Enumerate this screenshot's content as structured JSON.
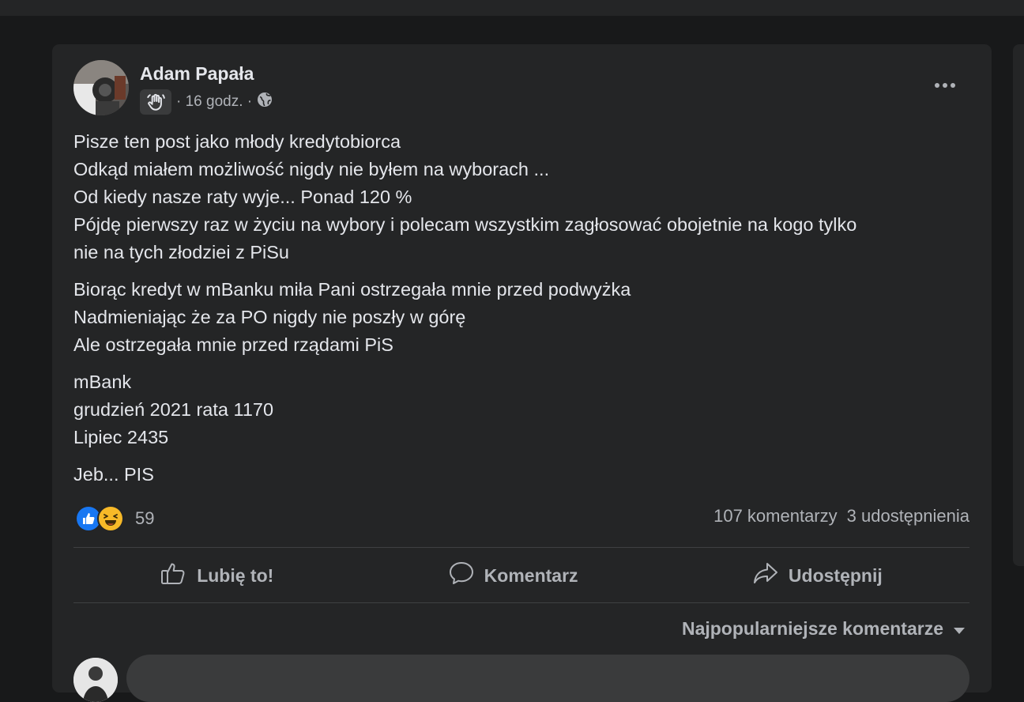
{
  "post": {
    "author": "Adam Papała",
    "time": "· 16 godz. ·",
    "paragraphs": [
      [
        "Pisze ten post jako młody kredytobiorca",
        "Odkąd miałem możliwość nigdy nie byłem na wyborach ...",
        "Od kiedy nasze raty wyje... Ponad 120 %",
        "Pójdę pierwszy raz w życiu na wybory i polecam wszystkim zagłosować obojetnie na kogo tylko",
        "nie na tych złodziei z PiSu"
      ],
      [
        "Biorąc kredyt w mBanku miła Pani ostrzegała mnie przed podwyżka",
        "Nadmieniając że za PO nigdy nie poszły w górę",
        "Ale ostrzegała mnie przed rządami PiS"
      ],
      [
        "mBank",
        "grudzień 2021 rata 1170",
        "Lipiec 2435"
      ],
      [
        "Jeb... PIS"
      ]
    ]
  },
  "reactions": {
    "count": "59",
    "types": [
      "like",
      "haha"
    ]
  },
  "stats": {
    "comments": "107 komentarzy",
    "shares": "3 udostępnienia"
  },
  "actions": {
    "like": "Lubię to!",
    "comment": "Komentarz",
    "share": "Udostępnij"
  },
  "sort": {
    "label": "Najpopularniejsze komentarze"
  },
  "colors": {
    "background": "#18191a",
    "card": "#242526",
    "text_primary": "#e4e6eb",
    "text_secondary": "#b0b3b8",
    "like_blue": "#1877f2",
    "haha_yellow": "#f7b928"
  }
}
